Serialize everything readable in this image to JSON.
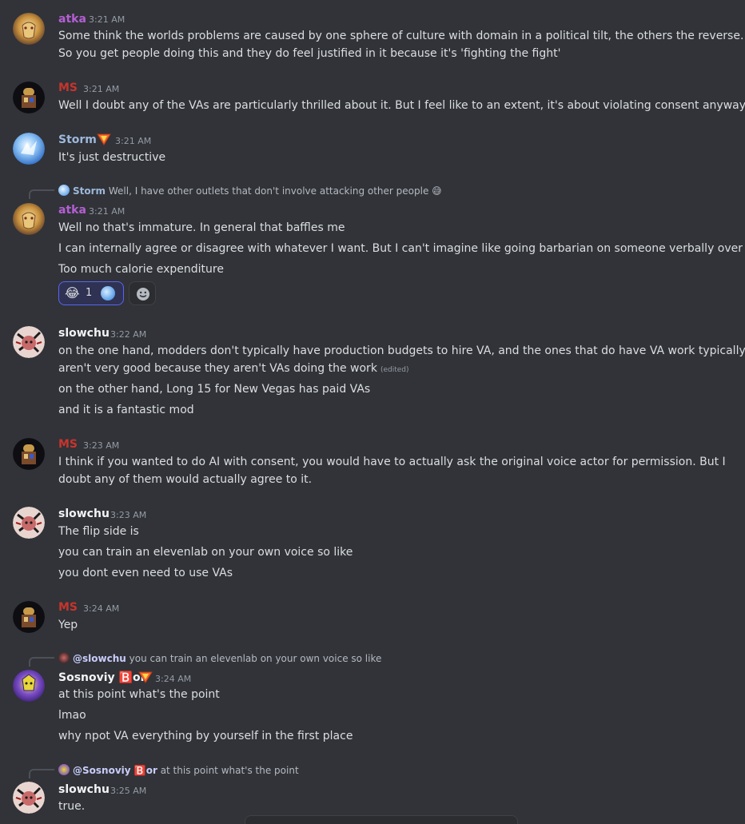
{
  "colors": {
    "background": "#313338",
    "atka_name": "#b45fd4",
    "ms_name": "#c8342c",
    "storm_name": "#9db8dc",
    "default_name": "#f2f3f5",
    "timestamp": "#949ba4"
  },
  "messages": [
    {
      "user": "atka",
      "time": "3:21 AM",
      "avatar": "atka-avatar",
      "lines": [
        "Some think the worlds problems are caused by one sphere of culture with domain in a political tilt, the others the reverse.",
        "So you get people doing this and they do feel justified in it because it's 'fighting the fight'"
      ]
    },
    {
      "user": "MS",
      "time": "3:21 AM",
      "avatar": "ms-avatar",
      "lines": [
        "Well I doubt any of the VAs are particularly thrilled about it. But I feel like to an extent, it's about violating consent anyway."
      ]
    },
    {
      "user": "Storm",
      "time": "3:21 AM",
      "avatar": "storm-avatar",
      "badge": "triangle-badge-icon",
      "lines": [
        "It's just destructive"
      ]
    },
    {
      "user": "atka",
      "time": "3:21 AM",
      "avatar": "atka-avatar",
      "reply": {
        "user": "Storm",
        "text": "Well, I have other outlets that don't involve attacking other people",
        "emoji": "😅"
      },
      "lines": [
        "Well no that's immature. In general that baffles me",
        "I can internally agree or disagree with whatever I want. But I can't imagine like going barbarian on someone verbally over it",
        "Too much calorie expenditure"
      ],
      "reactions": [
        {
          "emoji": "😂",
          "count": "1",
          "reactor": "storm-avatar"
        }
      ]
    },
    {
      "user": "slowchu",
      "time": "3:22 AM",
      "avatar": "slowchu-avatar",
      "lines": [
        "on the one hand, modders don't typically have production budgets to hire VA, and the ones that do have VA work typically",
        "aren't very good because they aren't VAs doing the work",
        "on the other hand, Long 15 for New Vegas has paid VAs",
        "and it is a fantastic mod"
      ],
      "edited": "(edited)"
    },
    {
      "user": "MS",
      "time": "3:23 AM",
      "avatar": "ms-avatar",
      "lines": [
        "I think if you wanted to do AI with consent, you would have to actually ask the original voice actor for permission. But I",
        "doubt any of them would actually agree to it."
      ]
    },
    {
      "user": "slowchu",
      "time": "3:23 AM",
      "avatar": "slowchu-avatar",
      "lines": [
        "The flip side is",
        "you can train an elevenlab on your own voice so like",
        "you dont even need to use VAs"
      ]
    },
    {
      "user": "MS",
      "time": "3:24 AM",
      "avatar": "ms-avatar",
      "lines": [
        "Yep"
      ]
    },
    {
      "user": "Sosnoviy 🅱️or",
      "time": "3:24 AM",
      "avatar": "sosnoviy-avatar",
      "badge": "triangle-badge-icon",
      "reply": {
        "user": "@slowchu",
        "text": "you can train an elevenlab on your own voice so like"
      },
      "lines": [
        "at this point what's the point",
        "lmao",
        "why npot VA everything by yourself in the first place"
      ]
    },
    {
      "user": "slowchu",
      "time": "3:25 AM",
      "avatar": "slowchu-avatar",
      "reply": {
        "user": "@Sosnoviy 🅱️or",
        "text": "at this point what's the point"
      },
      "lines": [
        "true."
      ]
    }
  ]
}
